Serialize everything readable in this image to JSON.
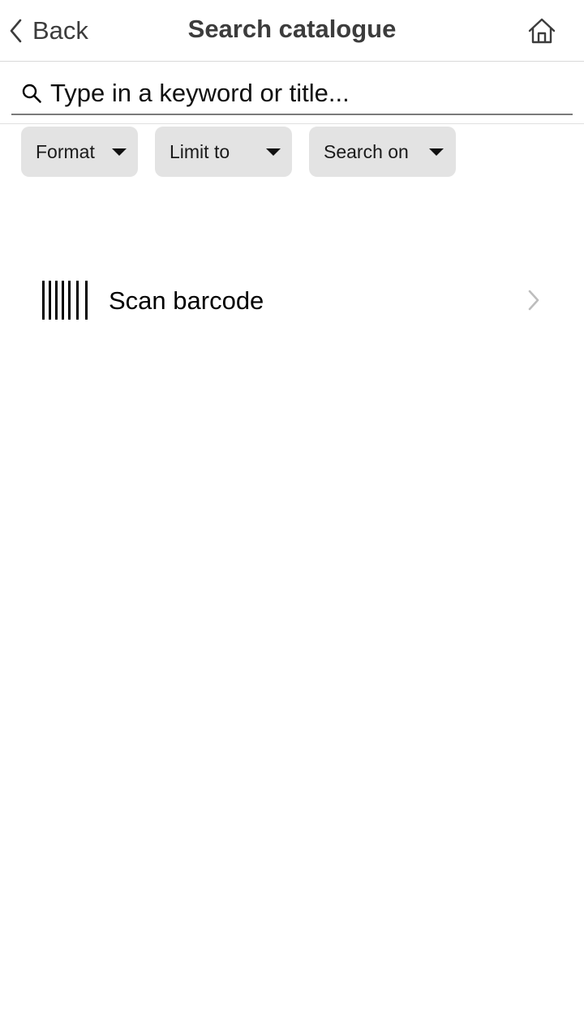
{
  "header": {
    "back_label": "Back",
    "title": "Search catalogue",
    "home_icon": "home-icon"
  },
  "search": {
    "placeholder": "Type in a keyword or title...",
    "value": ""
  },
  "filters": [
    {
      "label": "Format"
    },
    {
      "label": "Limit to"
    },
    {
      "label": "Search on"
    }
  ],
  "scan": {
    "label": "Scan barcode",
    "icon": "barcode-icon"
  },
  "colors": {
    "text": "#000000",
    "header_text": "#3c3c3c",
    "filter_bg": "#e3e3e3",
    "divider": "#d9d9d9",
    "chevron": "#bdbdbd"
  }
}
